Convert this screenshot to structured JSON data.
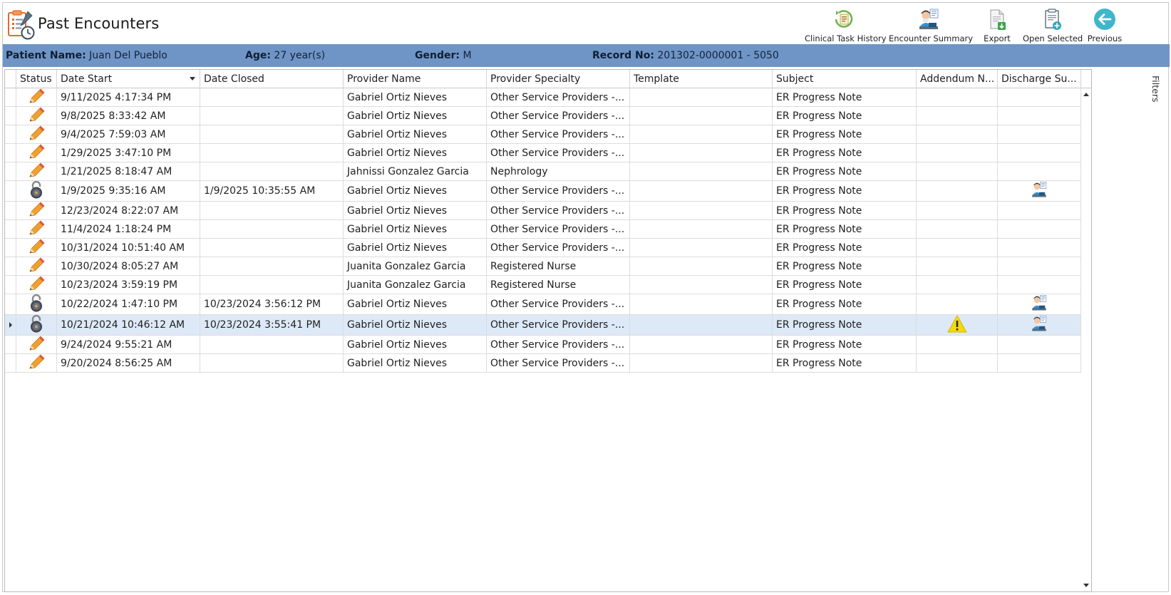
{
  "header": {
    "title": "Past Encounters",
    "app_icon": "clipboard-clock-icon"
  },
  "toolbar": [
    {
      "label": "Clinical Task History",
      "icon": "task-history-icon"
    },
    {
      "label": "Encounter Summary",
      "icon": "encounter-summary-icon"
    },
    {
      "label": "Export",
      "icon": "export-icon"
    },
    {
      "label": "Open Selected",
      "icon": "open-selected-icon"
    },
    {
      "label": "Previous",
      "icon": "previous-arrow-icon"
    }
  ],
  "patient": {
    "name_label": "Patient Name:",
    "name": "Juan Del Pueblo",
    "age_label": "Age:",
    "age": "27 year(s)",
    "gender_label": "Gender:",
    "gender": "M",
    "record_label": "Record No:",
    "record": "201302-0000001 - 5050"
  },
  "grid": {
    "columns": [
      "Status",
      "Date Start",
      "Date Closed",
      "Provider Name",
      "Provider Specialty",
      "Template",
      "Subject",
      "Addendum N...",
      "Discharge Su..."
    ],
    "sorted_column": "Date Start",
    "rows": [
      {
        "status": "edit",
        "date_start": "9/11/2025 4:17:34 PM",
        "date_closed": "",
        "provider": "Gabriel Ortiz Nieves",
        "specialty": "Other Service Providers -...",
        "template": "",
        "subject": "ER Progress Note",
        "addendum": "",
        "discharge": ""
      },
      {
        "status": "edit",
        "date_start": "9/8/2025 8:33:42 AM",
        "date_closed": "",
        "provider": "Gabriel Ortiz Nieves",
        "specialty": "Other Service Providers -...",
        "template": "",
        "subject": "ER Progress Note",
        "addendum": "",
        "discharge": ""
      },
      {
        "status": "edit",
        "date_start": "9/4/2025 7:59:03 AM",
        "date_closed": "",
        "provider": "Gabriel Ortiz Nieves",
        "specialty": "Other Service Providers -...",
        "template": "",
        "subject": "ER Progress Note",
        "addendum": "",
        "discharge": ""
      },
      {
        "status": "edit",
        "date_start": "1/29/2025 3:47:10 PM",
        "date_closed": "",
        "provider": "Gabriel Ortiz Nieves",
        "specialty": "Other Service Providers -...",
        "template": "",
        "subject": "ER Progress Note",
        "addendum": "",
        "discharge": ""
      },
      {
        "status": "edit",
        "date_start": "1/21/2025 8:18:47 AM",
        "date_closed": "",
        "provider": "Jahnissi Gonzalez Garcia",
        "specialty": "Nephrology",
        "template": "",
        "subject": "ER Progress Note",
        "addendum": "",
        "discharge": ""
      },
      {
        "status": "locked",
        "date_start": "1/9/2025 9:35:16 AM",
        "date_closed": "1/9/2025 10:35:55 AM",
        "provider": "Gabriel Ortiz Nieves",
        "specialty": "Other Service Providers -...",
        "template": "",
        "subject": "ER Progress Note",
        "addendum": "",
        "discharge": "summary"
      },
      {
        "status": "edit",
        "date_start": "12/23/2024 8:22:07 AM",
        "date_closed": "",
        "provider": "Gabriel Ortiz Nieves",
        "specialty": "Other Service Providers -...",
        "template": "",
        "subject": "ER Progress Note",
        "addendum": "",
        "discharge": ""
      },
      {
        "status": "edit",
        "date_start": "11/4/2024 1:18:24 PM",
        "date_closed": "",
        "provider": "Gabriel Ortiz Nieves",
        "specialty": "Other Service Providers -...",
        "template": "",
        "subject": "ER Progress Note",
        "addendum": "",
        "discharge": ""
      },
      {
        "status": "edit",
        "date_start": "10/31/2024 10:51:40 AM",
        "date_closed": "",
        "provider": "Gabriel Ortiz Nieves",
        "specialty": "Other Service Providers -...",
        "template": "",
        "subject": "ER Progress Note",
        "addendum": "",
        "discharge": ""
      },
      {
        "status": "edit",
        "date_start": "10/30/2024 8:05:27 AM",
        "date_closed": "",
        "provider": "Juanita Gonzalez Garcia",
        "specialty": "Registered Nurse",
        "template": "",
        "subject": "ER Progress Note",
        "addendum": "",
        "discharge": ""
      },
      {
        "status": "edit",
        "date_start": "10/23/2024 3:59:19 PM",
        "date_closed": "",
        "provider": "Juanita Gonzalez Garcia",
        "specialty": "Registered Nurse",
        "template": "",
        "subject": "ER Progress Note",
        "addendum": "",
        "discharge": ""
      },
      {
        "status": "locked",
        "date_start": "10/22/2024 1:47:10 PM",
        "date_closed": "10/23/2024 3:56:12 PM",
        "provider": "Gabriel Ortiz Nieves",
        "specialty": "Other Service Providers -...",
        "template": "",
        "subject": "ER Progress Note",
        "addendum": "",
        "discharge": "summary"
      },
      {
        "status": "locked",
        "date_start": "10/21/2024 10:46:12 AM",
        "date_closed": "10/23/2024 3:55:41 PM",
        "provider": "Gabriel Ortiz Nieves",
        "specialty": "Other Service Providers -...",
        "template": "",
        "subject": "ER Progress Note",
        "addendum": "warning",
        "discharge": "summary",
        "selected": true
      },
      {
        "status": "edit",
        "date_start": "9/24/2024 9:55:21 AM",
        "date_closed": "",
        "provider": "Gabriel Ortiz Nieves",
        "specialty": "Other Service Providers -...",
        "template": "",
        "subject": "ER Progress Note",
        "addendum": "",
        "discharge": ""
      },
      {
        "status": "edit",
        "date_start": "9/20/2024 8:56:25 AM",
        "date_closed": "",
        "provider": "Gabriel Ortiz Nieves",
        "specialty": "Other Service Providers -...",
        "template": "",
        "subject": "ER Progress Note",
        "addendum": "",
        "discharge": ""
      }
    ]
  },
  "side_panel": {
    "filters_label": "Filters"
  },
  "colors": {
    "patient_bar": "#6f95c6",
    "selected_row": "#dde9f6",
    "pencil": "#f0a030",
    "warning": "#f5d90f",
    "previous_button": "#3fb6c9"
  }
}
